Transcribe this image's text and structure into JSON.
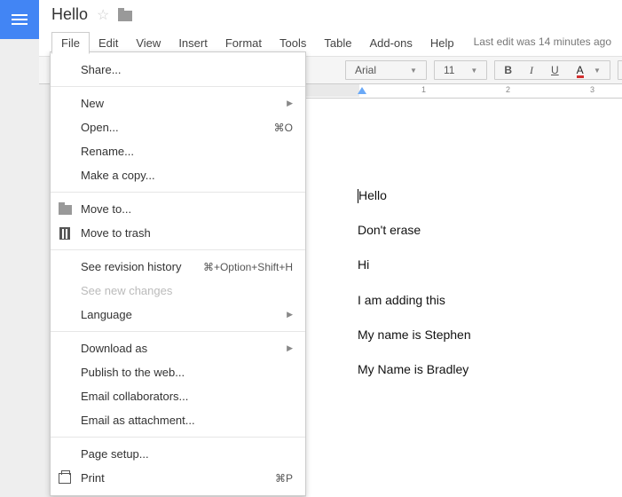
{
  "title": "Hello",
  "menubar": [
    "File",
    "Edit",
    "View",
    "Insert",
    "Format",
    "Tools",
    "Table",
    "Add-ons",
    "Help"
  ],
  "last_edit": "Last edit was 14 minutes ago",
  "toolbar": {
    "font": "Arial",
    "size": "11",
    "bold": "B",
    "italic": "I",
    "underline": "U",
    "textcolor": "A"
  },
  "file_menu": {
    "share": "Share...",
    "new": "New",
    "open": "Open...",
    "open_sc": "⌘O",
    "rename": "Rename...",
    "copy": "Make a copy...",
    "moveto": "Move to...",
    "trash": "Move to trash",
    "revhist": "See revision history",
    "revhist_sc": "⌘+Option+Shift+H",
    "newchanges": "See new changes",
    "language": "Language",
    "download": "Download as",
    "publish": "Publish to the web...",
    "emailcollab": "Email collaborators...",
    "emailattach": "Email as attachment...",
    "pagesetup": "Page setup...",
    "print": "Print",
    "print_sc": "⌘P"
  },
  "ruler": {
    "n1": "1",
    "n2": "2",
    "n3": "3"
  },
  "document": {
    "l1": "Hello",
    "l2": "Don't erase",
    "l3": "Hi",
    "l4": "I am adding this",
    "l5": "My name is Stephen",
    "l6": "My Name is Bradley"
  }
}
